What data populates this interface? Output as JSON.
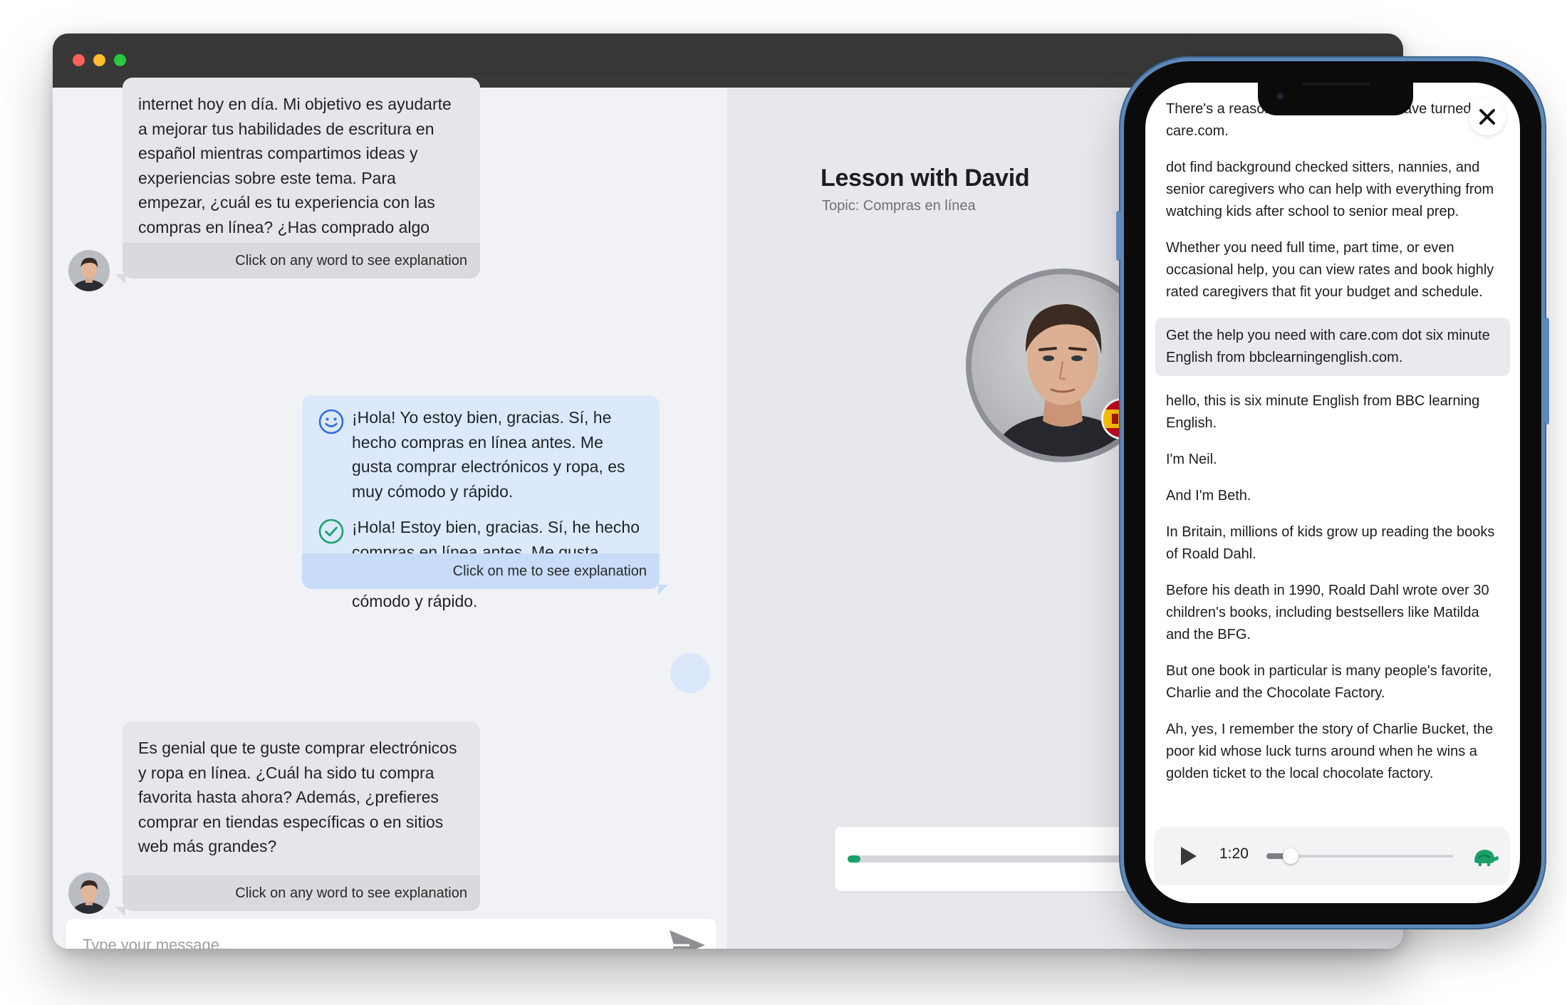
{
  "chat": {
    "messages": [
      {
        "role": "tutor",
        "text": "internet hoy en día. Mi objetivo es ayudarte a mejorar tus habilidades de escritura en español mientras compartimos ideas y experiencias sobre este tema. Para empezar, ¿cuál es tu experiencia con las compras en línea? ¿Has comprado algo recientemente?",
        "footer": "Click on any word to see explanation"
      },
      {
        "role": "user",
        "original": "¡Hola! Yo estoy bien, gracias. Sí, he hecho compras en línea antes. Me gusta comprar electrónicos y ropa, es muy cómodo y rápido.",
        "corrected": "¡Hola! Estoy bien, gracias. Sí, he hecho compras en línea antes. Me gusta comprar electrónicos y ropa; es muy cómodo y rápido.",
        "footer": "Click on me to see explanation"
      },
      {
        "role": "tutor",
        "text": "Es genial que te guste comprar electrónicos y ropa en línea. ¿Cuál ha sido tu compra favorita hasta ahora? Además, ¿prefieres comprar en tiendas específicas o en sitios web más grandes?",
        "footer": "Click on any word to see explanation"
      }
    ],
    "input_placeholder": "Type your message..."
  },
  "lesson": {
    "title": "Lesson with David",
    "topic": "Topic: Compras en línea",
    "progress_fraction": 0.03
  },
  "phone": {
    "transcript": [
      "There's a reason millions of families have turned to care.com.",
      "dot find background checked sitters, nannies, and senior caregivers who can help with everything from watching kids after school to senior meal prep.",
      "Whether you need full time, part time, or even occasional help, you can view rates and book highly rated caregivers that fit your budget and schedule.",
      "Get the help you need with care.com dot six minute English from bbclearningenglish.com.",
      "hello, this is six minute English from BBC learning English.",
      "I'm Neil.",
      "And I'm Beth.",
      "In Britain, millions of kids grow up reading the books of Roald Dahl.",
      "Before his death in 1990, Roald Dahl wrote over 30 children's books, including bestsellers like Matilda and the BFG.",
      "But one book in particular is many people's favorite, Charlie and the Chocolate Factory.",
      "Ah, yes, I remember the story of Charlie Bucket, the poor kid whose luck turns around when he wins a golden ticket to the local chocolate factory."
    ],
    "active_index": 3,
    "player": {
      "time": "1:20",
      "progress_fraction": 0.13
    }
  },
  "colors": {
    "accent_green": "#1aa06a",
    "user_bubble": "#dce9fb",
    "tutor_bubble": "#e5e6e9"
  },
  "icons": [
    "smiley-icon",
    "check-circle-icon",
    "send-icon",
    "close-icon",
    "play-icon",
    "turtle-speed-icon"
  ]
}
